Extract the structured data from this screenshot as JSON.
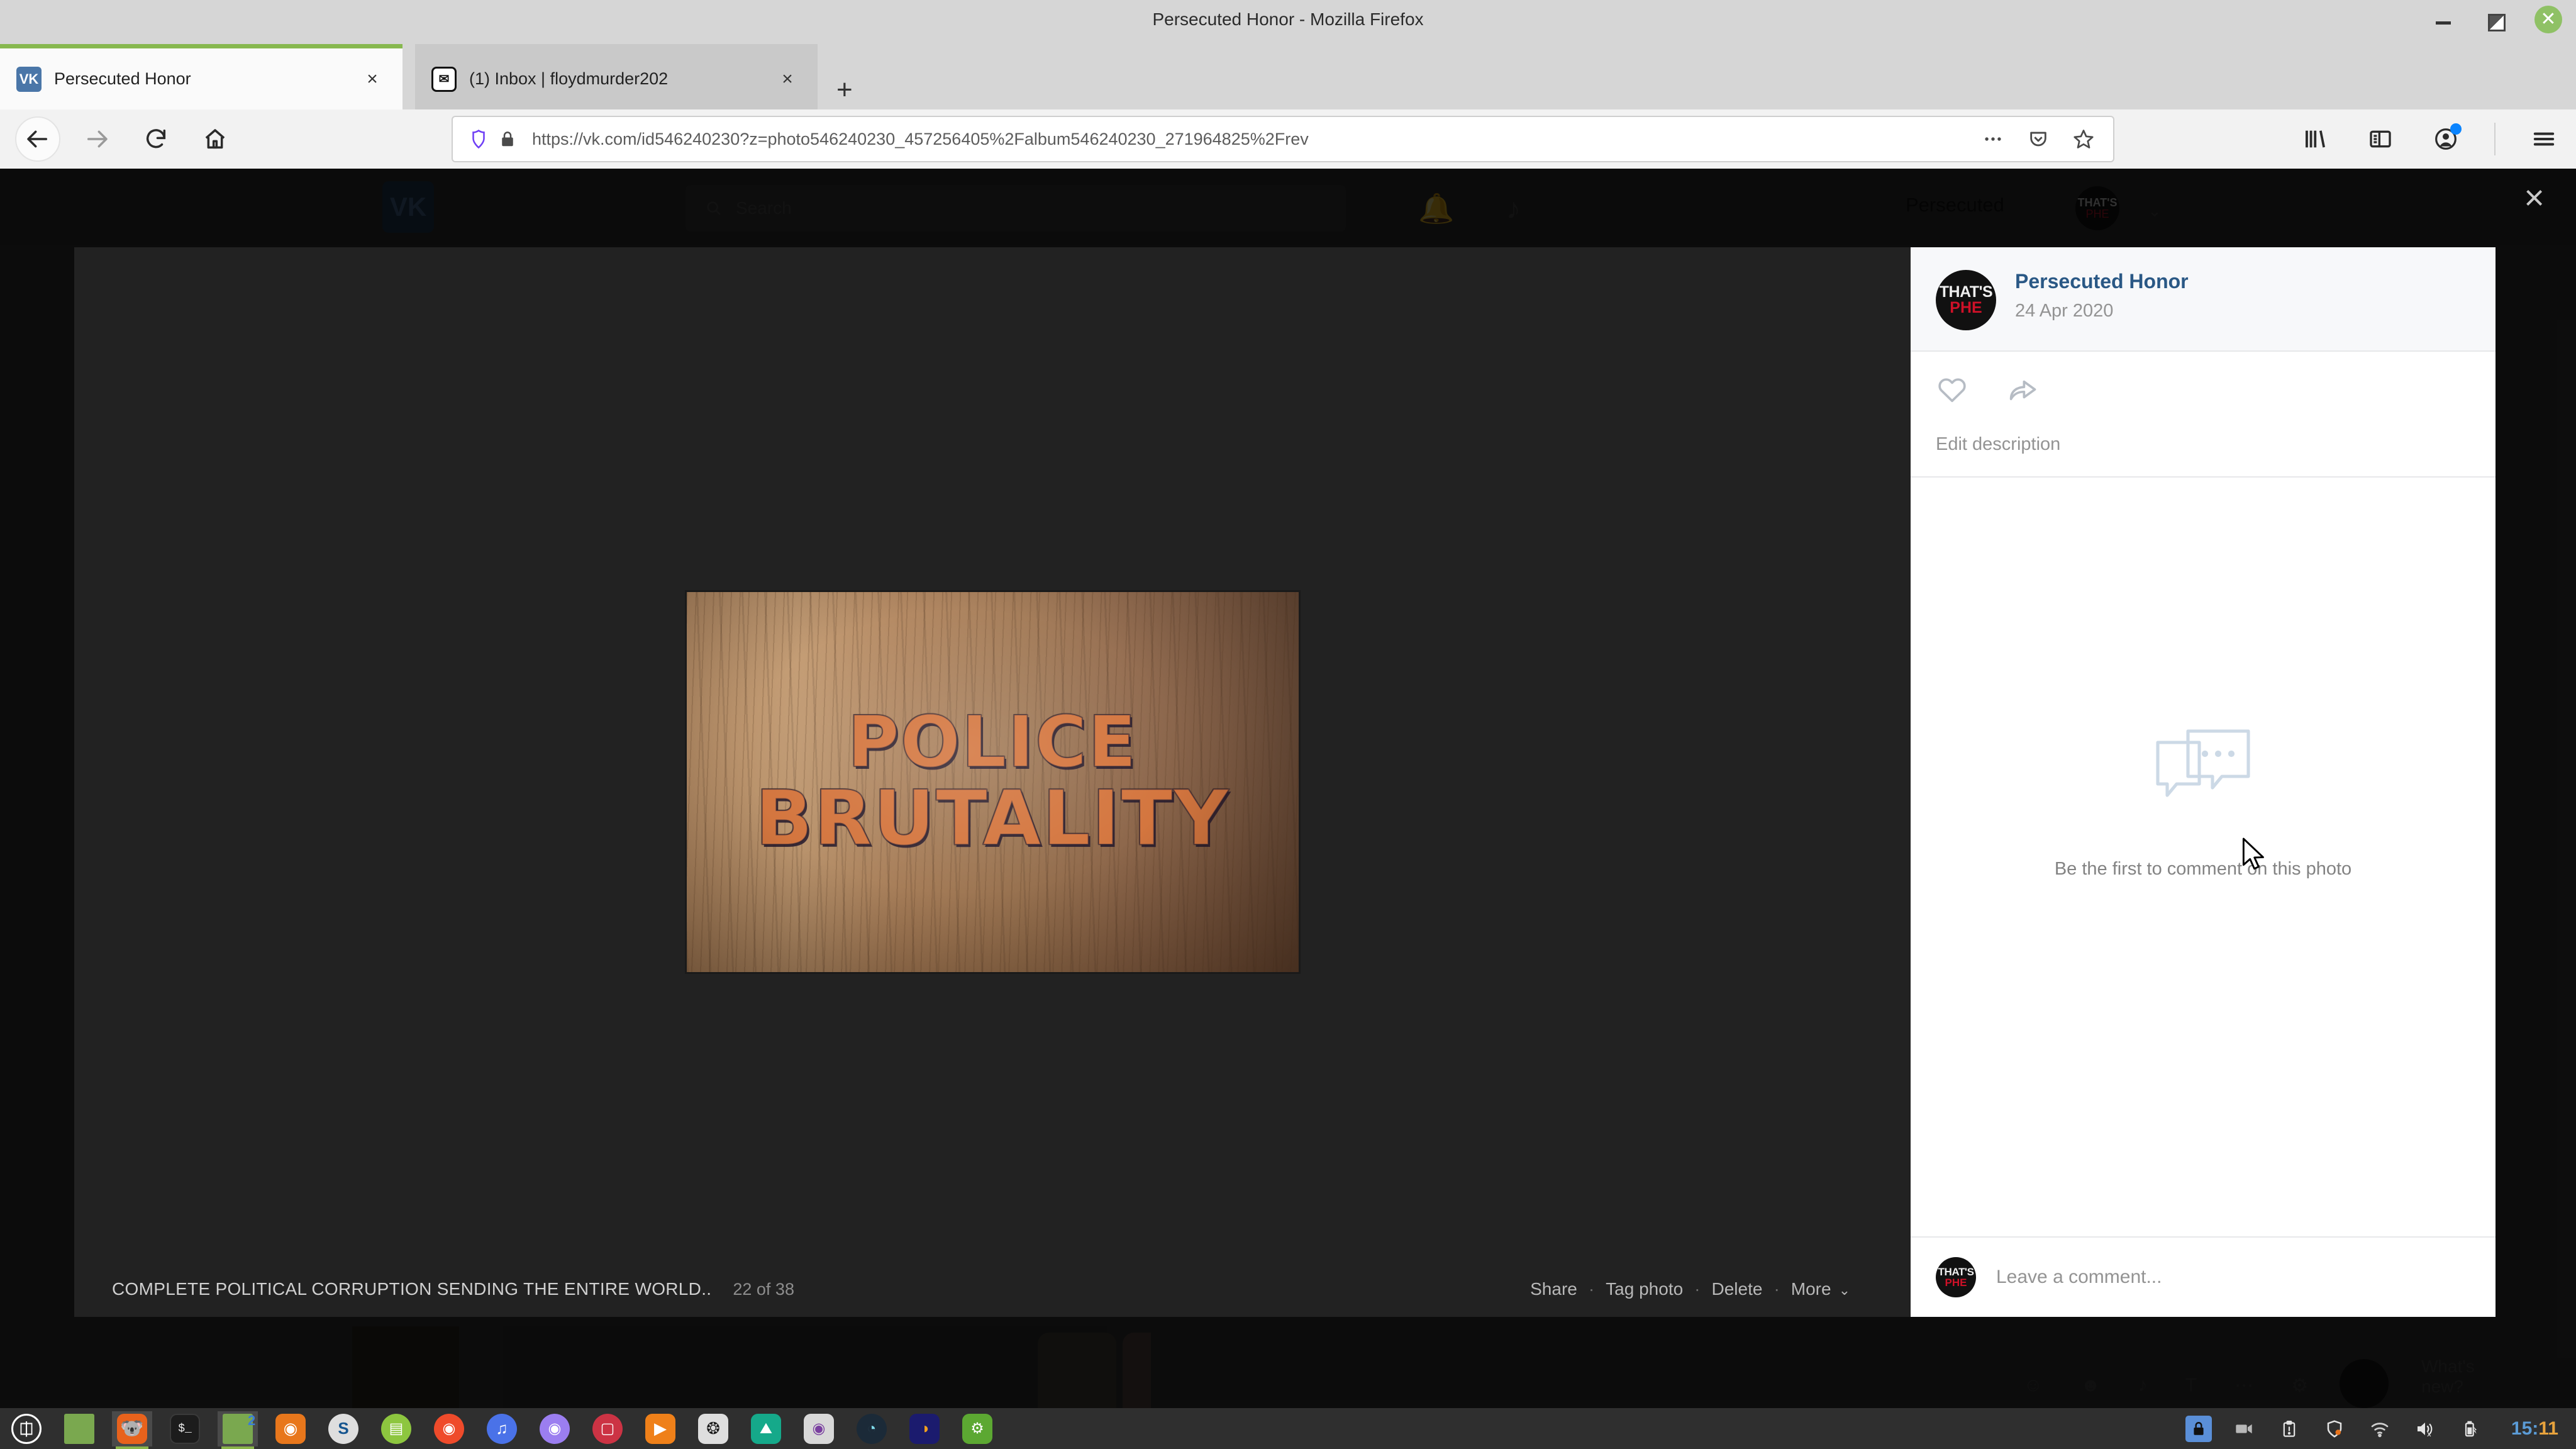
{
  "window": {
    "title": "Persecuted Honor - Mozilla Firefox",
    "minimize_label": "Minimize",
    "maximize_label": "Restore",
    "close_label": "Close"
  },
  "tabs": [
    {
      "title": "Persecuted Honor",
      "favicon": "vk-icon",
      "active": true,
      "close_label": "×"
    },
    {
      "title": "(1) Inbox | floydmurder202",
      "favicon": "mail-icon",
      "active": false,
      "close_label": "×"
    }
  ],
  "newtab_label": "+",
  "nav": {
    "back_label": "Back",
    "forward_label": "Forward",
    "reload_label": "Reload",
    "home_label": "Home"
  },
  "urlbar": {
    "url": "https://vk.com/id546240230?z=photo546240230_457256405%2Falbum546240230_271964825%2Frev",
    "shield_icon": "tracking-protection-icon",
    "lock_icon": "padlock-icon",
    "page_actions_icon": "ellipsis-icon",
    "pocket_icon": "pocket-icon",
    "bookmark_icon": "star-icon"
  },
  "toolbar_right": {
    "library_label": "Library",
    "sidebar_label": "Sidebars",
    "account_label": "Account",
    "menu_label": "Open menu",
    "account_badge_color": "#0a84ff"
  },
  "vk_background": {
    "logo_text": "VK",
    "search_placeholder": "Search",
    "bell_icon": "bell-icon",
    "music_icon": "music-note-icon",
    "user_name": "Persecuted",
    "chevron": "⌄",
    "post_placeholder": "What's new?"
  },
  "viewer": {
    "close_label": "×",
    "photo": {
      "line1": "POLICE",
      "line2": "BRUTALITY",
      "alt": "Wooden letterpress blocks spelling POLICE BRUTALITY"
    },
    "caption": "COMPLETE POLITICAL CORRUPTION SENDING THE ENTIRE WORLD..",
    "counter": "22 of 38",
    "actions": [
      {
        "label": "Share"
      },
      {
        "label": "Tag photo"
      },
      {
        "label": "Delete"
      },
      {
        "label": "More"
      }
    ],
    "action_separator": "·",
    "more_chevron": "⌄"
  },
  "sidebar": {
    "author_name": "Persecuted Honor",
    "date": "24 Apr 2020",
    "avatar": {
      "top_text": "THAT'S",
      "bottom_text": "PHE",
      "accent": "#cf1128"
    },
    "like_icon": "heart-icon",
    "share_icon": "share-arrow-icon",
    "edit_description_label": "Edit description",
    "empty_icon": "comment-bubbles-icon",
    "empty_text": "Be the first to comment on this photo",
    "compose_placeholder": "Leave a comment...",
    "compose_avatar": {
      "top_text": "THAT'S",
      "bottom_text": "PHE"
    }
  },
  "taskbar": {
    "menu_label": "Menu",
    "apps": [
      {
        "name": "linux-mint-menu",
        "glyph": "Ⓜ",
        "bg": "transparent",
        "fg": "#ffffff",
        "shape": "circle"
      },
      {
        "name": "files-window",
        "glyph": "",
        "bg": "#7aa84f",
        "fg": "#ffffff",
        "shape": "square"
      },
      {
        "name": "firefox",
        "glyph": "🦊",
        "bg": "#e8621c",
        "fg": "#ffffff",
        "shape": "square"
      },
      {
        "name": "terminal",
        "glyph": "$_",
        "bg": "#1c1c1c",
        "fg": "#f0f0f0",
        "shape": "square"
      },
      {
        "name": "files-window-2",
        "glyph": "",
        "bg": "#7aa84f",
        "fg": "#ffffff",
        "shape": "square"
      },
      {
        "name": "blender",
        "glyph": "◎",
        "bg": "#e8771c",
        "fg": "#ffffff",
        "shape": "square"
      },
      {
        "name": "synfig",
        "glyph": "S",
        "bg": "#dedede",
        "fg": "#1a5fa8",
        "shape": "circle"
      },
      {
        "name": "shotcut",
        "glyph": "▣",
        "bg": "#8dc63f",
        "fg": "#ffffff",
        "shape": "circle"
      },
      {
        "name": "camera-app",
        "glyph": "◎",
        "bg": "#ef4b2b",
        "fg": "#ffffff",
        "shape": "circle"
      },
      {
        "name": "music-cloud",
        "glyph": "♪",
        "bg": "#4a72e8",
        "fg": "#ffffff",
        "shape": "circle"
      },
      {
        "name": "audio-player",
        "glyph": "◎",
        "bg": "#9b7ef0",
        "fg": "#ffffff",
        "shape": "circle"
      },
      {
        "name": "image-viewer",
        "glyph": "❑",
        "bg": "#cc3344",
        "fg": "#ffffff",
        "shape": "circle"
      },
      {
        "name": "media-play",
        "glyph": "▶",
        "bg": "#ef8019",
        "fg": "#ffffff",
        "shape": "square"
      },
      {
        "name": "inkscape",
        "glyph": "❂",
        "bg": "#dedede",
        "fg": "#1a1a1a",
        "shape": "square"
      },
      {
        "name": "gallery",
        "glyph": "⛰",
        "bg": "#15a98a",
        "fg": "#ffffff",
        "shape": "square"
      },
      {
        "name": "webcam",
        "glyph": "◉",
        "bg": "#d8d8d8",
        "fg": "#7a3fa0",
        "shape": "square"
      },
      {
        "name": "disk-usage",
        "glyph": "◔",
        "bg": "#1b2a38",
        "fg": "#7fd8e8",
        "shape": "circle"
      },
      {
        "name": "audacity",
        "glyph": "◑",
        "bg": "#1b1b6e",
        "fg": "#f0a020",
        "shape": "square"
      },
      {
        "name": "settings-tools",
        "glyph": "🔧",
        "bg": "#5ca832",
        "fg": "#ffffff",
        "shape": "square"
      }
    ],
    "tray": [
      {
        "name": "lock-keys-icon",
        "glyph": "🔒",
        "highlight": true
      },
      {
        "name": "screen-recorder-icon",
        "glyph": "▣"
      },
      {
        "name": "clipboard-icon",
        "glyph": "⌧"
      },
      {
        "name": "update-shield-icon",
        "glyph": "⛨"
      },
      {
        "name": "wifi-icon",
        "glyph": "◠"
      },
      {
        "name": "volume-muted-icon",
        "glyph": "🔈"
      },
      {
        "name": "battery-charging-icon",
        "glyph": "▯"
      }
    ],
    "clock": {
      "hours": "15",
      "separator": ":",
      "minutes": "11"
    }
  }
}
